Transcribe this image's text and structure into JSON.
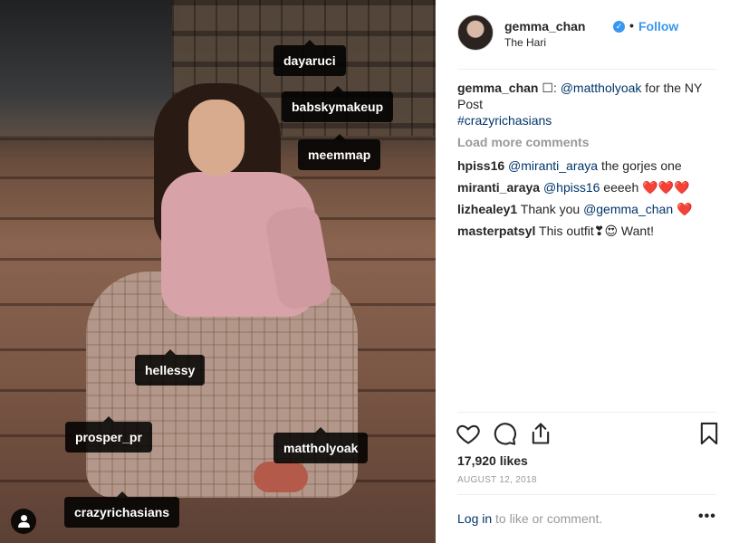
{
  "post": {
    "username": "gemma_chan",
    "verified_symbol": "✓",
    "separator": "•",
    "follow_label": "Follow",
    "location": "The Hari",
    "photo_tags": [
      "dayaruci",
      "babskymakeup",
      "meemmap",
      "hellessy",
      "prosper_pr",
      "mattholyoak",
      "crazyrichasians"
    ]
  },
  "comments": {
    "caption": {
      "user": "gemma_chan",
      "symbol": "☐",
      "colon": ":",
      "mention": "@mattholyoak",
      "text": " for the NY Post",
      "hashtag": "#crazyrichasians"
    },
    "load_more": "Load more comments",
    "items": [
      {
        "user": "hpiss16",
        "mention": "@miranti_araya",
        "text": " the gorjes one",
        "emoji": ""
      },
      {
        "user": "miranti_araya",
        "mention": "@hpiss16",
        "text": " eeeeh ",
        "emoji": "❤️❤️❤️"
      },
      {
        "user": "lizhealey1",
        "mention": "@gemma_chan",
        "text": "Thank you ",
        "emoji": "❤️"
      },
      {
        "user": "masterpatsyl",
        "mention": "",
        "text": "This outfit❣😍  Want!",
        "emoji": ""
      }
    ]
  },
  "footer": {
    "likes": "17,920 likes",
    "date": "AUGUST 12, 2018",
    "login_link": "Log in",
    "login_text": " to like or comment.",
    "more": "•••"
  },
  "icons": [
    "heart-outline-icon",
    "comment-icon",
    "share-icon",
    "bookmark-icon",
    "user-tag-icon"
  ],
  "colors": {
    "link": "#003569",
    "follow": "#3897f0",
    "muted": "#999999",
    "heart": "#e0262d"
  }
}
